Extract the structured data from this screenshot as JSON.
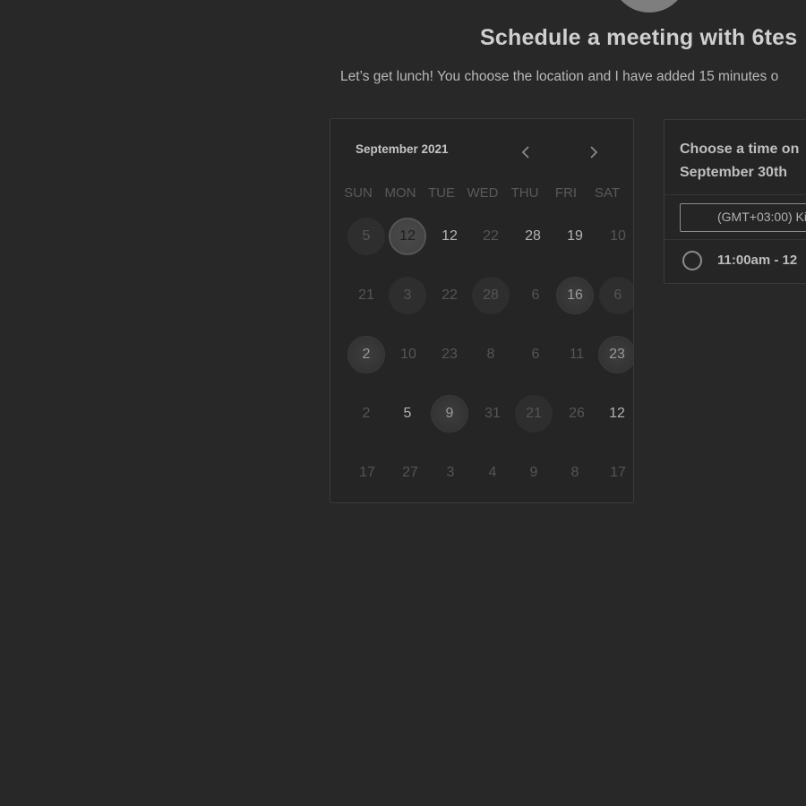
{
  "header": {
    "title": "Schedule a meeting with 6tes",
    "subtitle": "Let’s get lunch! You choose the location and I have added 15 minutes o"
  },
  "calendar": {
    "month_label": "September 2021",
    "prev_icon": "chevron-left-icon",
    "next_icon": "chevron-right-icon",
    "weekdays": [
      "SUN",
      "MON",
      "TUE",
      "WED",
      "THU",
      "FRI",
      "SAT"
    ],
    "weeks": [
      [
        "5",
        "12",
        "12",
        "22",
        "28",
        "19",
        "10"
      ],
      [
        "21",
        "3",
        "22",
        "28",
        "6",
        "16",
        "6"
      ],
      [
        "2",
        "10",
        "23",
        "8",
        "6",
        "11",
        "23"
      ],
      [
        "2",
        "5",
        "9",
        "31",
        "21",
        "26",
        "12"
      ],
      [
        "17",
        "27",
        "3",
        "4",
        "9",
        "8",
        "17"
      ]
    ]
  },
  "times": {
    "heading_line1": "Choose a time on",
    "heading_line2": "September 30th",
    "timezone": "(GMT+03:00) Ki",
    "slots": [
      {
        "label": "11:00am - 12"
      }
    ]
  }
}
